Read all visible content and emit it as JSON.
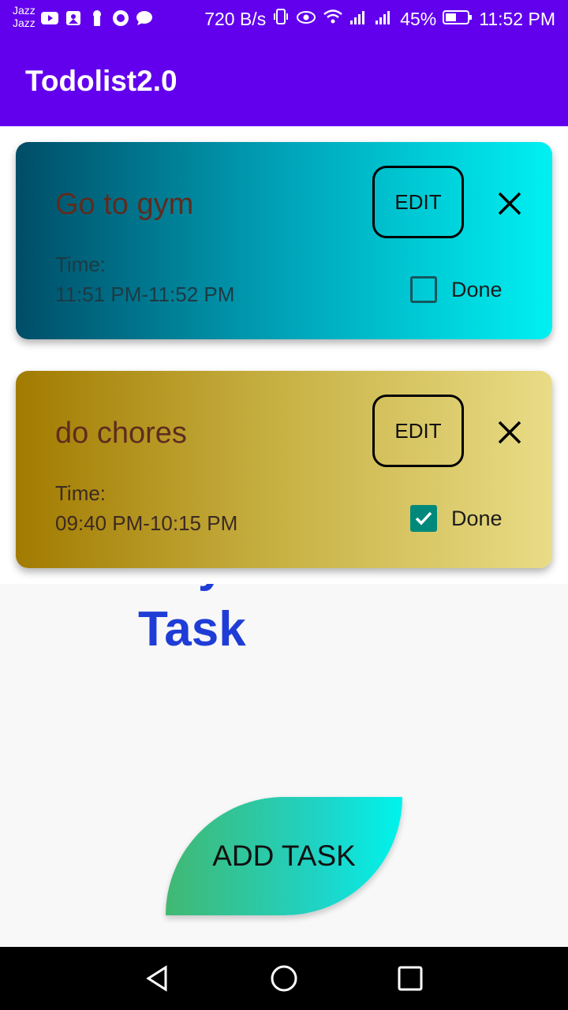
{
  "status_bar": {
    "carrier_top": "Jazz",
    "carrier_bottom": "Jazz",
    "net_speed": "720 B/s",
    "battery": "45%",
    "time": "11:52 PM"
  },
  "app_bar": {
    "title": "Todolist2.0"
  },
  "tasks": [
    {
      "title": "Go to gym",
      "time_label": "Time:",
      "time_range": "11:51 PM-11:52 PM",
      "edit_label": "EDIT",
      "done_label": "Done",
      "done": false,
      "gradient": [
        "#004d67",
        "#00f0f2"
      ]
    },
    {
      "title": "do chores",
      "time_label": "Time:",
      "time_range": "09:40 PM-10:15 PM",
      "edit_label": "EDIT",
      "done_label": "Done",
      "done": true,
      "gradient": [
        "#a27b00",
        "#e9dc86"
      ]
    }
  ],
  "background_hint": {
    "line1": "of your all",
    "line2": "Task"
  },
  "add_button": {
    "label": "ADD TASK"
  },
  "colors": {
    "primary": "#6200ee",
    "hint_text": "#1f3dd6",
    "checkbox": "#00897b"
  },
  "nav_bar": {
    "icons": [
      "back-icon",
      "home-icon",
      "recents-icon"
    ]
  }
}
